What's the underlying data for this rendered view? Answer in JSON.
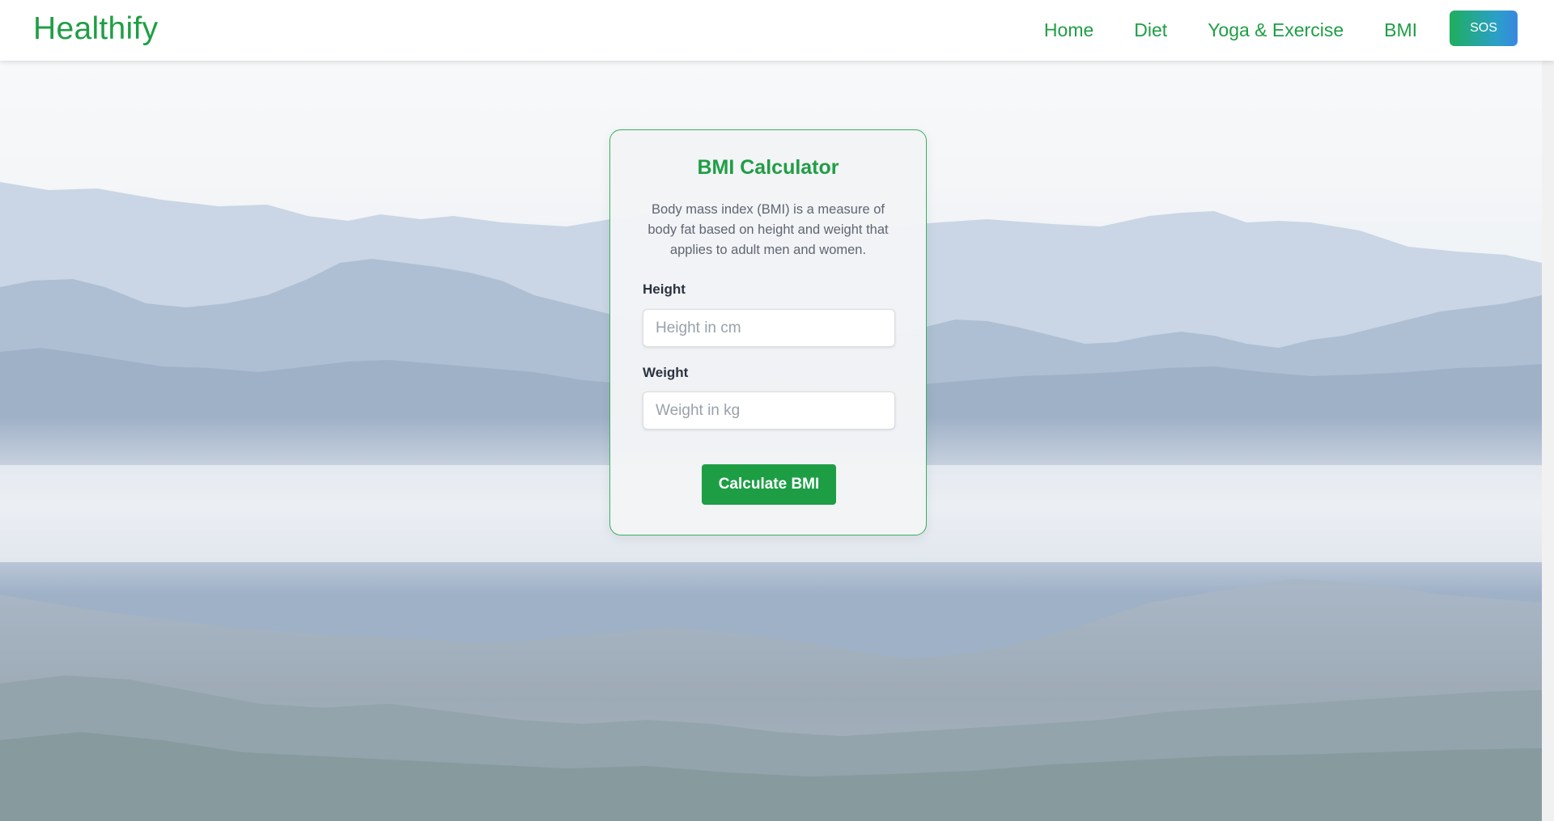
{
  "header": {
    "brand": "Healthify",
    "nav": [
      {
        "label": "Home"
      },
      {
        "label": "Diet"
      },
      {
        "label": "Yoga & Exercise"
      },
      {
        "label": "BMI"
      }
    ],
    "sos_label": "SOS"
  },
  "bmi_card": {
    "title": "BMI Calculator",
    "description": "Body mass index (BMI) is a measure of body fat based on height and weight that applies to adult men and women.",
    "height": {
      "label": "Height",
      "placeholder": "Height in cm",
      "value": ""
    },
    "weight": {
      "label": "Weight",
      "placeholder": "Weight in kg",
      "value": ""
    },
    "submit_label": "Calculate BMI"
  },
  "colors": {
    "brand_green": "#1f9e45",
    "button_green": "#1d9e45",
    "sos_gradient_start": "#1fae5d",
    "sos_gradient_end": "#3a87e0",
    "card_border": "#35b35f"
  }
}
